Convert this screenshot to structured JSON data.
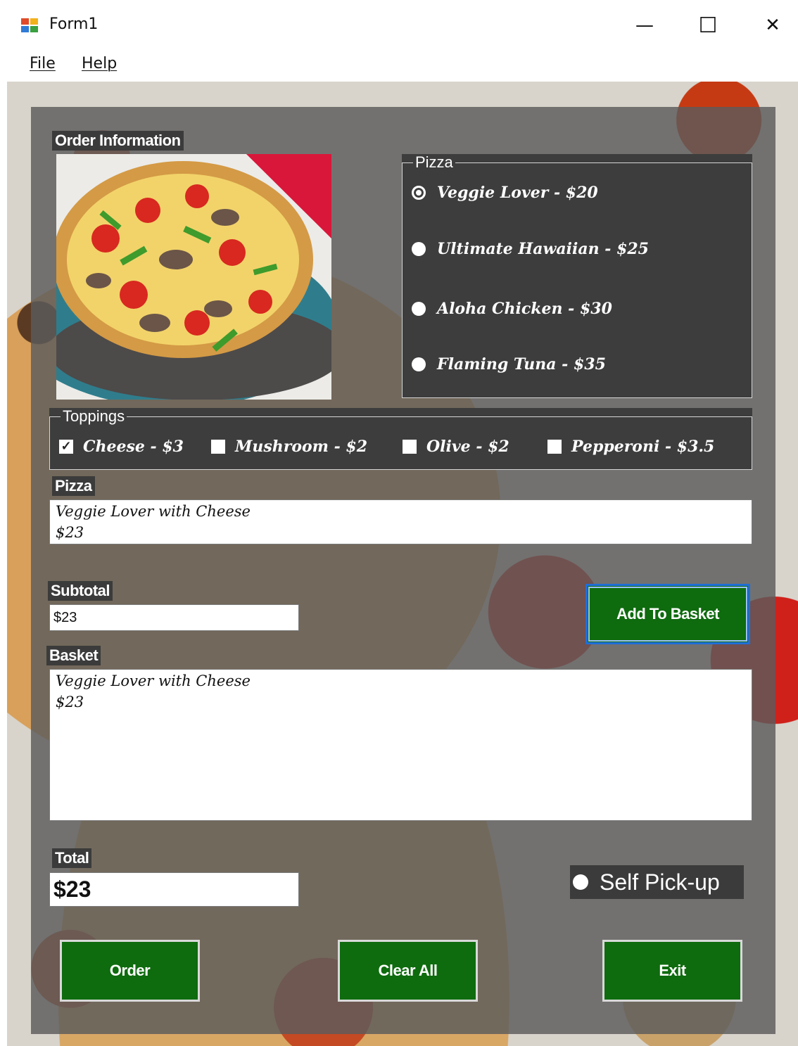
{
  "window": {
    "title": "Form1",
    "minimize_glyph": "—",
    "maximize_glyph": "☐",
    "close_glyph": "✕"
  },
  "menu": {
    "file": "File",
    "help": "Help"
  },
  "order_info": {
    "label": "Order Information"
  },
  "pizza_group": {
    "title": "Pizza",
    "options": [
      {
        "label": "Veggie Lover - $20",
        "selected": true
      },
      {
        "label": "Ultimate Hawaiian - $25",
        "selected": false
      },
      {
        "label": "Aloha Chicken - $30",
        "selected": false
      },
      {
        "label": "Flaming Tuna - $35",
        "selected": false
      }
    ]
  },
  "toppings_group": {
    "title": "Toppings",
    "items": [
      {
        "label": "Cheese - $3",
        "checked": true
      },
      {
        "label": "Mushroom - $2",
        "checked": false
      },
      {
        "label": "Olive - $2",
        "checked": false
      },
      {
        "label": "Pepperoni - $3.5",
        "checked": false
      }
    ]
  },
  "pizza_summary": {
    "label": "Pizza",
    "line1": "Veggie Lover with Cheese",
    "line2": "$23"
  },
  "subtotal": {
    "label": "Subtotal",
    "value": "$23"
  },
  "add_to_basket": "Add To Basket",
  "basket": {
    "label": "Basket",
    "line1": "Veggie Lover with Cheese",
    "line2": "$23"
  },
  "total": {
    "label": "Total",
    "value": "$23"
  },
  "self_pickup": {
    "label": "Self Pick-up",
    "selected": false
  },
  "buttons": {
    "order": "Order",
    "clear_all": "Clear All",
    "exit": "Exit"
  },
  "colors": {
    "button_green": "#0e6b0e",
    "overlay_gray": "#5c5c5c",
    "groupbox_dark": "#3d3d3d",
    "focus_blue": "#1f6fd8"
  }
}
